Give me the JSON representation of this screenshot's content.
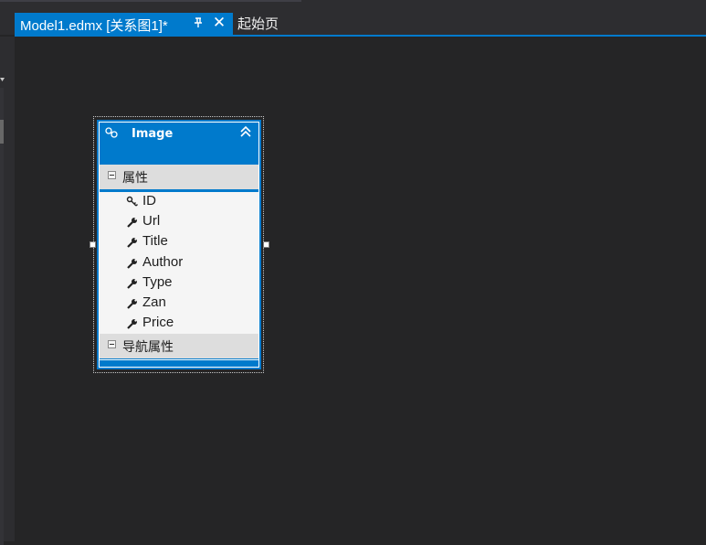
{
  "tabs": {
    "active_label": "Model1.edmx [关系图1]*",
    "inactive_label": "起始页"
  },
  "entity": {
    "name": "Image",
    "properties_section": "属性",
    "navigation_section": "导航属性",
    "properties": [
      {
        "name": "ID",
        "icon": "key-icon"
      },
      {
        "name": "Url",
        "icon": "wrench-icon"
      },
      {
        "name": "Title",
        "icon": "wrench-icon"
      },
      {
        "name": "Author",
        "icon": "wrench-icon"
      },
      {
        "name": "Type",
        "icon": "wrench-icon"
      },
      {
        "name": "Zan",
        "icon": "wrench-icon"
      },
      {
        "name": "Price",
        "icon": "wrench-icon"
      }
    ]
  },
  "colors": {
    "accent": "#007acc",
    "background": "#252526",
    "section_bg": "#dddddd",
    "property_bg": "#f5f5f5"
  }
}
